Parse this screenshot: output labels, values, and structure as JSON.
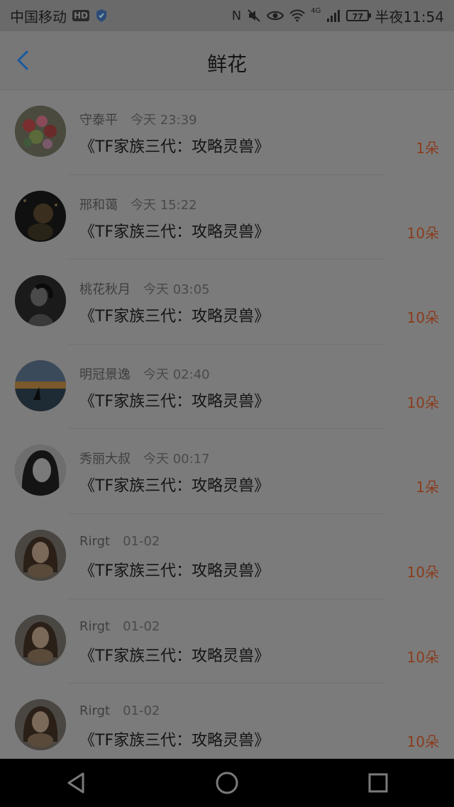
{
  "status_bar": {
    "carrier": "中国移动",
    "hd_badge": "HD",
    "network_label": "4G",
    "battery_level": "77",
    "time": "半夜11:54"
  },
  "header": {
    "title": "鲜花"
  },
  "items": [
    {
      "user": "守泰平",
      "time": "今天 23:39",
      "book": "《TF家族三代：攻略灵兽》",
      "count": "1朵"
    },
    {
      "user": "邢和蔼",
      "time": "今天 15:22",
      "book": "《TF家族三代：攻略灵兽》",
      "count": "10朵"
    },
    {
      "user": "桃花秋月",
      "time": "今天 03:05",
      "book": "《TF家族三代：攻略灵兽》",
      "count": "10朵"
    },
    {
      "user": "明冠景逸",
      "time": "今天 02:40",
      "book": "《TF家族三代：攻略灵兽》",
      "count": "10朵"
    },
    {
      "user": "秀丽大叔",
      "time": "今天 00:17",
      "book": "《TF家族三代：攻略灵兽》",
      "count": "1朵"
    },
    {
      "user": "Rirgt",
      "time": "01-02",
      "book": "《TF家族三代：攻略灵兽》",
      "count": "10朵"
    },
    {
      "user": "Rirgt",
      "time": "01-02",
      "book": "《TF家族三代：攻略灵兽》",
      "count": "10朵"
    },
    {
      "user": "Rirgt",
      "time": "01-02",
      "book": "《TF家族三代：攻略灵兽》",
      "count": "10朵"
    }
  ],
  "colors": {
    "accent": "#1a5aa0",
    "count_text": "#8a3c1d",
    "overlay_background": "#7b7b7b"
  },
  "icons": {
    "back": "chevron-left-icon",
    "nav_back": "triangle-back-icon",
    "nav_home": "circle-home-icon",
    "nav_recent": "square-recent-icon"
  }
}
